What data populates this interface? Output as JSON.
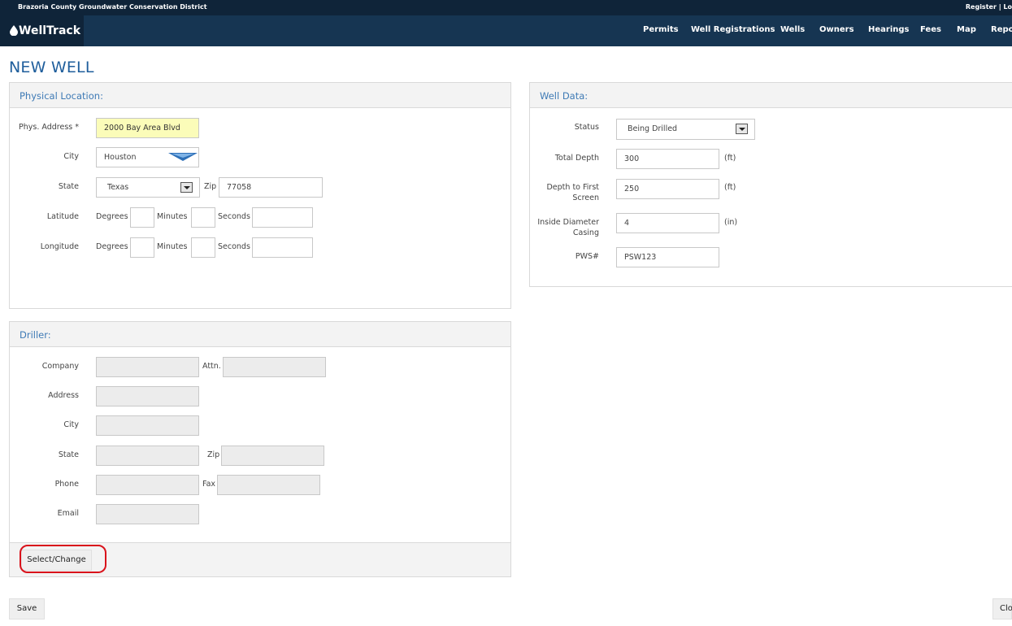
{
  "topbar": {
    "org_name": "Brazoria County Groundwater Conservation District",
    "register": "Register",
    "separator": "|",
    "login": "Lo"
  },
  "brand": {
    "name": "WellTrack",
    "icon": "water-drop-icon"
  },
  "nav": [
    "Permits",
    "Well Registrations",
    "Wells",
    "Owners",
    "Hearings",
    "Fees",
    "Map",
    "Repo"
  ],
  "page": {
    "title": "NEW WELL"
  },
  "physical_location": {
    "heading": "Physical Location:",
    "address_label": "Phys. Address *",
    "address_value": "2000 Bay Area Blvd",
    "city_label": "City",
    "city_value": "Houston",
    "state_label": "State",
    "state_value": "Texas",
    "zip_label": "Zip",
    "zip_value": "77058",
    "latitude_label": "Latitude",
    "longitude_label": "Longitude",
    "degrees_label": "Degrees",
    "minutes_label": "Minutes",
    "seconds_label": "Seconds"
  },
  "well_data": {
    "heading": "Well Data:",
    "status_label": "Status",
    "status_value": "Being Drilled",
    "total_depth_label": "Total Depth",
    "total_depth_value": "300",
    "total_depth_unit": "(ft)",
    "first_screen_label_1": "Depth to First",
    "first_screen_label_2": "Screen",
    "first_screen_value": "250",
    "first_screen_unit": "(ft)",
    "casing_label_1": "Inside Diameter",
    "casing_label_2": "Casing",
    "casing_value": "4",
    "casing_unit": "(in)",
    "pws_label": "PWS#",
    "pws_value": "PSW123"
  },
  "driller": {
    "heading": "Driller:",
    "company_label": "Company",
    "attn_label": "Attn.",
    "address_label": "Address",
    "city_label": "City",
    "state_label": "State",
    "zip_label": "Zip",
    "phone_label": "Phone",
    "fax_label": "Fax",
    "email_label": "Email",
    "select_button": "Select/Change"
  },
  "actions": {
    "save": "Save",
    "close": "Clo"
  },
  "colors": {
    "topbar": "#0f2439",
    "navbar": "#163552",
    "title": "#1f5e9c",
    "highlight": "#d9121b",
    "required_field": "#fbfcb9"
  }
}
